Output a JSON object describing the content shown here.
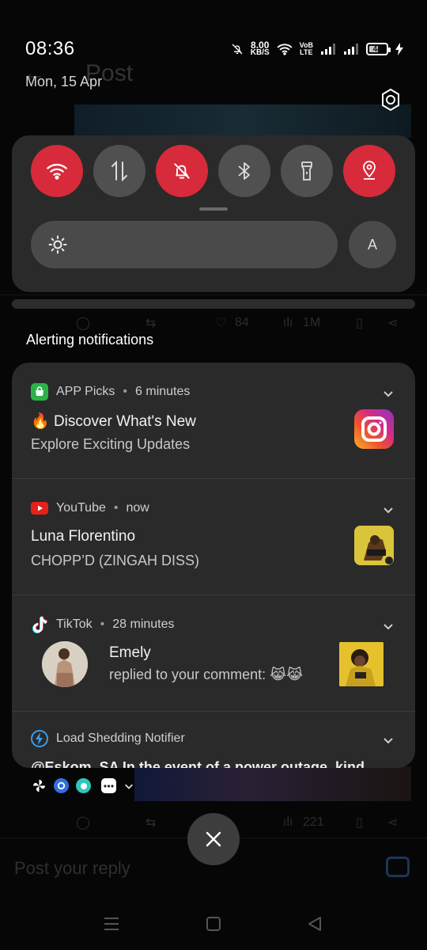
{
  "status": {
    "time": "08:36",
    "date": "Mon, 15 Apr",
    "net_speed_value": "8.00",
    "net_speed_unit": "KB/S",
    "volte_top": "VoB",
    "volte_bottom": "LTE",
    "battery_level": "44"
  },
  "background": {
    "screen_title": "Post",
    "likes_count": "84",
    "views_count": "1M",
    "likes_count_2": "221",
    "reply_placeholder": "Post your reply"
  },
  "quick_settings": {
    "tiles": [
      {
        "name": "wifi",
        "icon": "wifi-icon",
        "on": true
      },
      {
        "name": "mobile-data",
        "icon": "data-arrows-icon",
        "on": false
      },
      {
        "name": "silent",
        "icon": "bell-off-icon",
        "on": true
      },
      {
        "name": "bluetooth",
        "icon": "bluetooth-icon",
        "on": false
      },
      {
        "name": "flashlight",
        "icon": "flashlight-icon",
        "on": false
      },
      {
        "name": "location",
        "icon": "location-icon",
        "on": true
      }
    ],
    "auto_brightness_label": "A",
    "colors": {
      "on": "#d72a3a",
      "off": "#505050"
    }
  },
  "section_title": "Alerting notifications",
  "notifications": [
    {
      "app": "APP Picks",
      "time": "6 minutes",
      "title_emoji": "🔥",
      "title": "Discover What's New",
      "body": "Explore Exciting Updates",
      "thumb_icon": "instagram-icon"
    },
    {
      "app": "YouTube",
      "time": "now",
      "title": "Luna Florentino",
      "body": "CHOPP’D (ZINGAH DISS)",
      "thumb_icon": "album-art"
    },
    {
      "app": "TikTok",
      "time": "28 minutes",
      "title": "Emely",
      "body": "replied to your comment: 😹😹",
      "thumb_icon": "photo-thumbnail"
    },
    {
      "app": "Load Shedding Notifier",
      "body": "@Eskom_SA In the event of a power outage, kind"
    }
  ],
  "separator_dot": "•"
}
